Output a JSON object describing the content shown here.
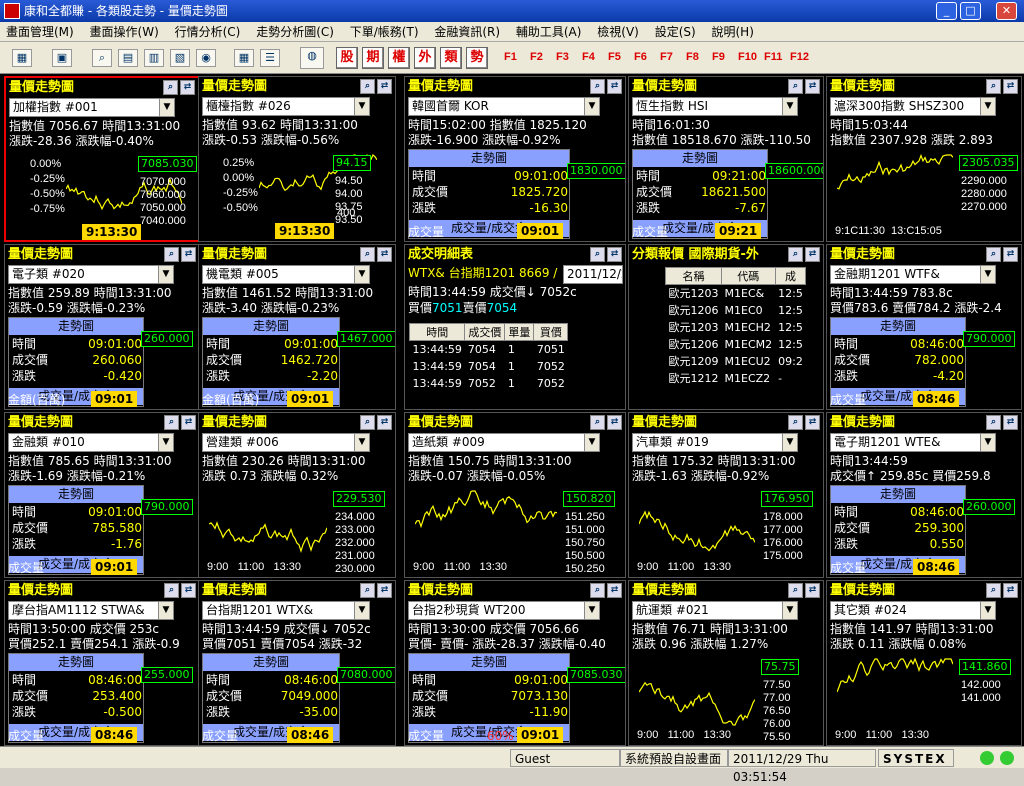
{
  "window": {
    "title": "康和全都賺 - 各類股走勢 - 量價走勢圖"
  },
  "menu": [
    "畫面管理(M)",
    "畫面操作(W)",
    "行情分析(C)",
    "走勢分析圖(C)",
    "下單/帳務(T)",
    "金融資訊(R)",
    "輔助工具(A)",
    "檢視(V)",
    "設定(S)",
    "說明(H)"
  ],
  "toolbar": {
    "red_buttons": [
      "股",
      "期",
      "權",
      "外",
      "類",
      "勢"
    ],
    "fkeys": [
      "F1",
      "F2",
      "F3",
      "F4",
      "F5",
      "F6",
      "F7",
      "F8",
      "F9",
      "F10",
      "F11",
      "F12"
    ]
  },
  "common": {
    "panel_title": "量價走勢圖",
    "trend_label": "走勢圖",
    "volume_label": "成交量/成交金",
    "index_label": "指數值",
    "time_label": "時間",
    "change_label": "漲跌",
    "amount_label": "金額(百萬)",
    "qty_label": "成交量",
    "deal_label": "成交價",
    "buy_label": "買價",
    "sell_label": "賣價"
  },
  "panels": [
    {
      "sel": "加權指數    #001",
      "l1": "指數值  7056.67  時間13:31:00",
      "l2": "漲跌-28.36  漲跌幅-0.40%",
      "ticks": [
        "0.00%",
        "-0.25%",
        "-0.50%",
        "-0.75%"
      ],
      "box": "7085.030",
      "rticks": [
        "7070.000",
        "7060.000",
        "7050.000",
        "7040.000"
      ],
      "tag": "9:13:30"
    },
    {
      "sel": "櫃檯指數    #026",
      "l1": "指數值  93.62  時間13:31:00",
      "l2": "漲跌-0.53  漲跌幅-0.56%",
      "ticks": [
        "0.25%",
        "0.00%",
        "-0.25%",
        "-0.50%"
      ],
      "box": "94.15",
      "rticks": [
        "94.50",
        "94.00",
        "93.75",
        "93.50"
      ],
      "tag": "9:13:30",
      "bottom": "400"
    },
    {
      "sel": "韓國首爾    KOR",
      "l1": "時間15:02:00  指數值   1825.120",
      "l2": "漲跌-16.900  漲跌幅-0.92%",
      "t": "09:01:00",
      "p": "1825.720",
      "ch": "-16.30",
      "box": "1830.000",
      "tag": "09:01"
    },
    {
      "sel": "恆生指數    HSI",
      "l1": "時間16:01:30",
      "l2": "指數值  18518.670  漲跌-110.50",
      "t": "09:21:00",
      "p": "18621.500",
      "ch": "-7.67",
      "box": "18600.000",
      "tag": "09:21"
    },
    {
      "sel": "滬深300指數    SHSZ300",
      "l1": "時間15:03:44",
      "l2": "指數值  2307.928  漲跌 2.893",
      "box": "2305.035",
      "rticks": [
        "2290.000",
        "2280.000",
        "2270.000"
      ],
      "xt": "9:1C11:30  13:C15:05"
    },
    {
      "sel": "電子類    #020",
      "l1": "指數值  259.89  時間13:31:00",
      "l2": "漲跌-0.59  漲跌幅-0.23%",
      "t": "09:01:00",
      "p": "260.060",
      "ch": "-0.420",
      "box": "260.000",
      "tag": "09:01"
    },
    {
      "sel": "機電類    #005",
      "l1": "指數值  1461.52  時間13:31:00",
      "l2": "漲跌-3.40  漲跌幅-0.23%",
      "t": "09:01:00",
      "p": "1462.720",
      "ch": "-2.20",
      "box": "1467.000",
      "tag": "09:01"
    },
    {
      "kind": "deal",
      "title": "成交明細表",
      "hdr": "WTX&  台指期1201  8669 /",
      "date": "2011/12/2",
      "l1": "時間13:44:59  成交價↓  7052c",
      "l2a": "買價",
      "l2b": "7051",
      "l2c": "賣價",
      "l2d": "7054",
      "cols": [
        "時間",
        "成交價",
        "單量",
        "買價"
      ],
      "rows": [
        [
          "13:44:59",
          "7054",
          "1",
          "7051"
        ],
        [
          "13:44:59",
          "7054",
          "1",
          "7052"
        ],
        [
          "13:44:59",
          "7052",
          "1",
          "7052"
        ]
      ]
    },
    {
      "kind": "quote",
      "title": "分類報價  國際期貨-外",
      "cols": [
        "名稱",
        "代碼",
        "成"
      ],
      "rows": [
        [
          "歐元1203",
          "M1EC&",
          "12:5"
        ],
        [
          "歐元1206",
          "M1EC0",
          "12:5"
        ],
        [
          "歐元1203",
          "M1ECH2",
          "12:5"
        ],
        [
          "歐元1206",
          "M1ECM2",
          "12:5"
        ],
        [
          "歐元1209",
          "M1ECU2",
          "09:2"
        ],
        [
          "歐元1212",
          "M1ECZ2",
          "-"
        ]
      ]
    },
    {
      "sel": "金融期1201    WTF&",
      "l1": "時間13:44:59        783.8c",
      "l2": "買價783.6  賣價784.2  漲跌-2.4",
      "t": "08:46:00",
      "p": "782.000",
      "ch": "-4.20",
      "box": "790.000",
      "tag": "08:46"
    },
    {
      "sel": "金融類    #010",
      "l1": "指數值  785.65  時間13:31:00",
      "l2": "漲跌-1.69  漲跌幅-0.21%",
      "t": "09:01:00",
      "p": "785.580",
      "ch": "-1.76",
      "box": "790.000",
      "tag": "09:01"
    },
    {
      "sel": "營建類    #006",
      "l1": "指數值  230.26  時間13:31:00",
      "l2": "漲跌 0.73  漲跌幅 0.32%",
      "box": "229.530",
      "rticks": [
        "234.000",
        "233.000",
        "232.000",
        "231.000",
        "230.000"
      ],
      "xt": "9:00   11:00   13:30"
    },
    {
      "sel": "造紙類    #009",
      "l1": "指數值  150.75  時間13:31:00",
      "l2": "漲跌-0.07  漲跌幅-0.05%",
      "box": "150.820",
      "rticks": [
        "151.250",
        "151.000",
        "150.750",
        "150.500",
        "150.250"
      ],
      "xt": "9:00   11:00   13:30"
    },
    {
      "sel": "汽車類    #019",
      "l1": "指數值  175.32  時間13:31:00",
      "l2": "漲跌-1.63  漲跌幅-0.92%",
      "box": "176.950",
      "rticks": [
        "178.000",
        "177.000",
        "176.000",
        "175.000"
      ],
      "xt": "9:00   11:00   13:30"
    },
    {
      "sel": "電子期1201    WTE&",
      "l1": "時間13:44:59",
      "l2": "成交價↑  259.85c  買價259.8",
      "t": "08:46:00",
      "p": "259.300",
      "ch": "0.550",
      "box": "260.000",
      "tag": "08:46"
    },
    {
      "sel": "摩台指AM1112    STWA&",
      "l1": "時間13:50:00  成交價     253c",
      "l2": "買價252.1  賣價254.1  漲跌-0.9",
      "t": "08:46:00",
      "p": "253.400",
      "ch": "-0.500",
      "box": "255.000",
      "tag": "08:46"
    },
    {
      "sel": "台指期1201    WTX&",
      "l1": "時間13:44:59  成交價↓  7052c",
      "l2": "買價7051  賣價7054  漲跌-32",
      "t": "08:46:00",
      "p": "7049.000",
      "ch": "-35.00",
      "box": "7080.000",
      "tag": "08:46"
    },
    {
      "sel": "台指2秒現貨    WT200",
      "l1": "時間13:30:00  成交價   7056.66",
      "l2": "買價-  賣價-  漲跌-28.37  漲跌幅-0.40",
      "t": "09:01:00",
      "p": "7073.130",
      "ch": "-11.90",
      "box": "7085.030",
      "tag": "09:01",
      "extra": "60%"
    },
    {
      "sel": "航運類    #021",
      "l1": "指數值  76.71  時間13:31:00",
      "l2": "漲跌 0.96  漲跌幅 1.27%",
      "box": "75.75",
      "rticks": [
        "77.50",
        "77.00",
        "76.50",
        "76.00",
        "75.50"
      ],
      "xt": "9:00   11:00   13:30"
    },
    {
      "sel": "其它類    #024",
      "l1": "指數值  141.97  時間13:31:00",
      "l2": "漲跌 0.11  漲跌幅 0.08%",
      "box": "141.860",
      "rticks": [
        "142.000",
        "141.000"
      ],
      "xt": "9:00   11:00   13:30"
    }
  ],
  "status": {
    "user": "Guest",
    "mode": "系統預設自設畫面",
    "datetime": "2011/12/29 Thu 03:51:54",
    "brand": "SYSTEX"
  }
}
